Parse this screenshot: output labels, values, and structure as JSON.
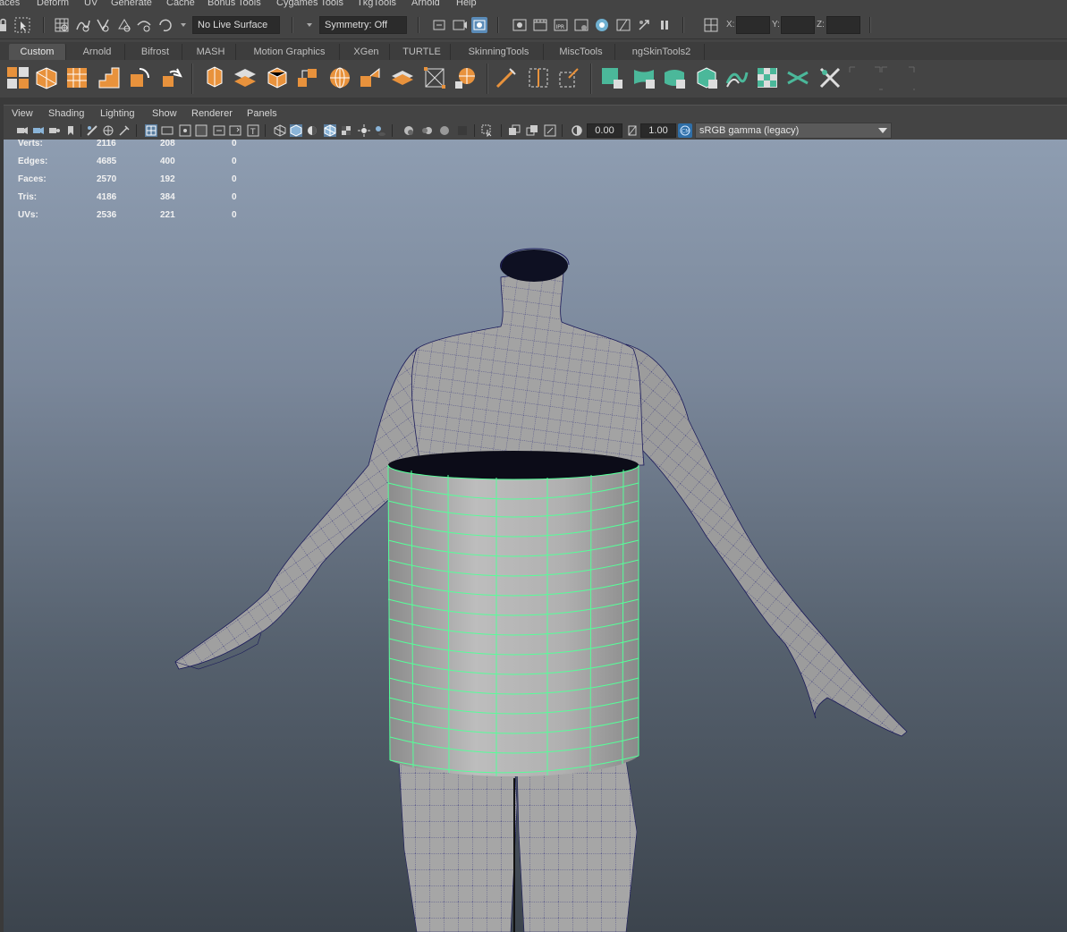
{
  "menubar": {
    "items": [
      "faces",
      "Deform",
      "UV",
      "Generate",
      "Cache",
      "Bonus Tools",
      "Cygames Tools",
      "TkgTools",
      "Arnold",
      "Help"
    ]
  },
  "statusline": {
    "live_surface": "No Live Surface",
    "symmetry": "Symmetry: Off",
    "x_label": "X:",
    "y_label": "Y:",
    "z_label": "Z:",
    "icons": [
      "snap-grid-icon",
      "snap-curve-icon",
      "snap-point-icon",
      "snap-view-plane-icon",
      "snap-live-icon",
      "snap-dropdown-icon",
      "render-view-icon",
      "render-frame-icon",
      "ipr-render-icon",
      "render-settings-icon",
      "hypershade-icon",
      "playblast-icon",
      "pause-icon",
      "modelling-toolkit-icon"
    ]
  },
  "shelf": {
    "tabs": [
      "Custom",
      "Arnold",
      "Bifrost",
      "MASH",
      "Motion Graphics",
      "XGen",
      "TURTLE",
      "SkinningTools",
      "MiscTools",
      "ngSkinTools2"
    ],
    "active_tab": "Custom",
    "accent_orange": "#e8923c",
    "accent_green": "#4bb89a"
  },
  "panel": {
    "menus": [
      "View",
      "Shading",
      "Lighting",
      "Show",
      "Renderer",
      "Panels"
    ],
    "exposure": "0.00",
    "gamma": "1.00",
    "color_space": "sRGB gamma (legacy)"
  },
  "hud": {
    "rows": [
      {
        "label": "Verts:",
        "total": "2116",
        "selected": "208",
        "components": "0"
      },
      {
        "label": "Edges:",
        "total": "4685",
        "selected": "400",
        "components": "0"
      },
      {
        "label": "Faces:",
        "total": "2570",
        "selected": "192",
        "components": "0"
      },
      {
        "label": "Tris:",
        "total": "4186",
        "selected": "384",
        "components": "0"
      },
      {
        "label": "UVs:",
        "total": "2536",
        "selected": "221",
        "components": "0"
      }
    ]
  },
  "viewport": {
    "background_top": "#8e9db1",
    "background_bottom": "#3c444d",
    "mesh_color": "#9a9a9a",
    "wire_color": "#1a1a6e",
    "selection_wire_color": "#55ff99"
  }
}
